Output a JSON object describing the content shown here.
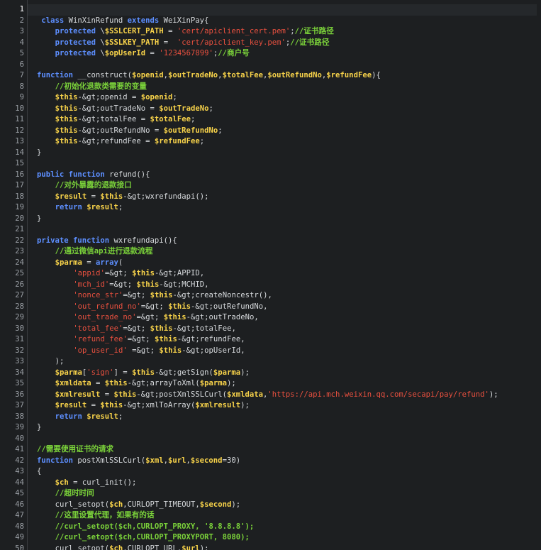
{
  "editor": {
    "lines": [
      {
        "n": "1",
        "indent": 0,
        "tokens": []
      },
      {
        "n": "2",
        "indent": 1,
        "tokens": [
          [
            "kw",
            "class"
          ],
          [
            "pl",
            " WinXinRefund "
          ],
          [
            "kw",
            "extends"
          ],
          [
            "pl",
            " WeiXinPay{"
          ]
        ]
      },
      {
        "n": "3",
        "indent": 4,
        "tokens": [
          [
            "kw",
            "protected"
          ],
          [
            "pl",
            " \\"
          ],
          [
            "var",
            "$SSLCERT_PATH"
          ],
          [
            "pl",
            " = "
          ],
          [
            "str",
            "'cert/apiclient_cert.pem'"
          ],
          [
            "pl",
            ";"
          ],
          [
            "cm",
            "//证书路径"
          ]
        ]
      },
      {
        "n": "4",
        "indent": 4,
        "tokens": [
          [
            "kw",
            "protected"
          ],
          [
            "pl",
            " \\"
          ],
          [
            "var",
            "$SSLKEY_PATH"
          ],
          [
            "pl",
            " =  "
          ],
          [
            "str",
            "'cert/apiclient_key.pem'"
          ],
          [
            "pl",
            ";"
          ],
          [
            "cm",
            "//证书路径"
          ]
        ]
      },
      {
        "n": "5",
        "indent": 4,
        "tokens": [
          [
            "kw",
            "protected"
          ],
          [
            "pl",
            " \\"
          ],
          [
            "var",
            "$opUserId"
          ],
          [
            "pl",
            " = "
          ],
          [
            "str",
            "'1234567899'"
          ],
          [
            "pl",
            ";"
          ],
          [
            "cm",
            "//商户号"
          ]
        ]
      },
      {
        "n": "6",
        "indent": 0,
        "tokens": []
      },
      {
        "n": "7",
        "indent": 0,
        "tokens": [
          [
            "kw",
            "function"
          ],
          [
            "pl",
            " __construct("
          ],
          [
            "var",
            "$openid"
          ],
          [
            "pl",
            ","
          ],
          [
            "var",
            "$outTradeNo"
          ],
          [
            "pl",
            ","
          ],
          [
            "var",
            "$totalFee"
          ],
          [
            "pl",
            ","
          ],
          [
            "var",
            "$outRefundNo"
          ],
          [
            "pl",
            ","
          ],
          [
            "var",
            "$refundFee"
          ],
          [
            "pl",
            "){"
          ]
        ]
      },
      {
        "n": "8",
        "indent": 4,
        "tokens": [
          [
            "cm",
            "//初始化退款类需要的变量"
          ]
        ]
      },
      {
        "n": "9",
        "indent": 4,
        "tokens": [
          [
            "var",
            "$this"
          ],
          [
            "pl",
            "-&gt;openid = "
          ],
          [
            "var",
            "$openid"
          ],
          [
            "pl",
            ";"
          ]
        ]
      },
      {
        "n": "10",
        "indent": 4,
        "tokens": [
          [
            "var",
            "$this"
          ],
          [
            "pl",
            "-&gt;outTradeNo = "
          ],
          [
            "var",
            "$outTradeNo"
          ],
          [
            "pl",
            ";"
          ]
        ]
      },
      {
        "n": "11",
        "indent": 4,
        "tokens": [
          [
            "var",
            "$this"
          ],
          [
            "pl",
            "-&gt;totalFee = "
          ],
          [
            "var",
            "$totalFee"
          ],
          [
            "pl",
            ";"
          ]
        ]
      },
      {
        "n": "12",
        "indent": 4,
        "tokens": [
          [
            "var",
            "$this"
          ],
          [
            "pl",
            "-&gt;outRefundNo = "
          ],
          [
            "var",
            "$outRefundNo"
          ],
          [
            "pl",
            ";"
          ]
        ]
      },
      {
        "n": "13",
        "indent": 4,
        "tokens": [
          [
            "var",
            "$this"
          ],
          [
            "pl",
            "-&gt;refundFee = "
          ],
          [
            "var",
            "$refundFee"
          ],
          [
            "pl",
            ";"
          ]
        ]
      },
      {
        "n": "14",
        "indent": 0,
        "tokens": [
          [
            "pl",
            "}"
          ]
        ]
      },
      {
        "n": "15",
        "indent": 0,
        "tokens": []
      },
      {
        "n": "16",
        "indent": 0,
        "tokens": [
          [
            "kw",
            "public"
          ],
          [
            "pl",
            " "
          ],
          [
            "kw",
            "function"
          ],
          [
            "pl",
            " refund(){"
          ]
        ]
      },
      {
        "n": "17",
        "indent": 4,
        "tokens": [
          [
            "cm",
            "//对外暴露的退款接口"
          ]
        ]
      },
      {
        "n": "18",
        "indent": 4,
        "tokens": [
          [
            "var",
            "$result"
          ],
          [
            "pl",
            " = "
          ],
          [
            "var",
            "$this"
          ],
          [
            "pl",
            "-&gt;wxrefundapi();"
          ]
        ]
      },
      {
        "n": "19",
        "indent": 4,
        "tokens": [
          [
            "kw",
            "return"
          ],
          [
            "pl",
            " "
          ],
          [
            "var",
            "$result"
          ],
          [
            "pl",
            ";"
          ]
        ]
      },
      {
        "n": "20",
        "indent": 0,
        "tokens": [
          [
            "pl",
            "}"
          ]
        ]
      },
      {
        "n": "21",
        "indent": 0,
        "tokens": []
      },
      {
        "n": "22",
        "indent": 0,
        "tokens": [
          [
            "kw",
            "private"
          ],
          [
            "pl",
            " "
          ],
          [
            "kw",
            "function"
          ],
          [
            "pl",
            " wxrefundapi(){"
          ]
        ]
      },
      {
        "n": "23",
        "indent": 4,
        "tokens": [
          [
            "cm",
            "//通过微信api进行退款流程"
          ]
        ]
      },
      {
        "n": "24",
        "indent": 4,
        "tokens": [
          [
            "var",
            "$parma"
          ],
          [
            "pl",
            " = "
          ],
          [
            "kw",
            "array"
          ],
          [
            "pl",
            "("
          ]
        ]
      },
      {
        "n": "25",
        "indent": 8,
        "tokens": [
          [
            "str",
            "'appid'"
          ],
          [
            "pl",
            "=&gt; "
          ],
          [
            "var",
            "$this"
          ],
          [
            "pl",
            "-&gt;APPID,"
          ]
        ]
      },
      {
        "n": "26",
        "indent": 8,
        "tokens": [
          [
            "str",
            "'mch_id'"
          ],
          [
            "pl",
            "=&gt; "
          ],
          [
            "var",
            "$this"
          ],
          [
            "pl",
            "-&gt;MCHID,"
          ]
        ]
      },
      {
        "n": "27",
        "indent": 8,
        "tokens": [
          [
            "str",
            "'nonce_str'"
          ],
          [
            "pl",
            "=&gt; "
          ],
          [
            "var",
            "$this"
          ],
          [
            "pl",
            "-&gt;createNoncestr(),"
          ]
        ]
      },
      {
        "n": "28",
        "indent": 8,
        "tokens": [
          [
            "str",
            "'out_refund_no'"
          ],
          [
            "pl",
            "=&gt; "
          ],
          [
            "var",
            "$this"
          ],
          [
            "pl",
            "-&gt;outRefundNo,"
          ]
        ]
      },
      {
        "n": "29",
        "indent": 8,
        "tokens": [
          [
            "str",
            "'out_trade_no'"
          ],
          [
            "pl",
            "=&gt; "
          ],
          [
            "var",
            "$this"
          ],
          [
            "pl",
            "-&gt;outTradeNo,"
          ]
        ]
      },
      {
        "n": "30",
        "indent": 8,
        "tokens": [
          [
            "str",
            "'total_fee'"
          ],
          [
            "pl",
            "=&gt; "
          ],
          [
            "var",
            "$this"
          ],
          [
            "pl",
            "-&gt;totalFee,"
          ]
        ]
      },
      {
        "n": "31",
        "indent": 8,
        "tokens": [
          [
            "str",
            "'refund_fee'"
          ],
          [
            "pl",
            "=&gt; "
          ],
          [
            "var",
            "$this"
          ],
          [
            "pl",
            "-&gt;refundFee,"
          ]
        ]
      },
      {
        "n": "32",
        "indent": 8,
        "tokens": [
          [
            "str",
            "'op_user_id'"
          ],
          [
            "pl",
            " =&gt; "
          ],
          [
            "var",
            "$this"
          ],
          [
            "pl",
            "-&gt;opUserId,"
          ]
        ]
      },
      {
        "n": "33",
        "indent": 4,
        "tokens": [
          [
            "pl",
            ");"
          ]
        ]
      },
      {
        "n": "34",
        "indent": 4,
        "tokens": [
          [
            "var",
            "$parma"
          ],
          [
            "pl",
            "["
          ],
          [
            "str",
            "'sign'"
          ],
          [
            "pl",
            "] = "
          ],
          [
            "var",
            "$this"
          ],
          [
            "pl",
            "-&gt;getSign("
          ],
          [
            "var",
            "$parma"
          ],
          [
            "pl",
            ");"
          ]
        ]
      },
      {
        "n": "35",
        "indent": 4,
        "tokens": [
          [
            "var",
            "$xmldata"
          ],
          [
            "pl",
            " = "
          ],
          [
            "var",
            "$this"
          ],
          [
            "pl",
            "-&gt;arrayToXml("
          ],
          [
            "var",
            "$parma"
          ],
          [
            "pl",
            ");"
          ]
        ]
      },
      {
        "n": "36",
        "indent": 4,
        "tokens": [
          [
            "var",
            "$xmlresult"
          ],
          [
            "pl",
            " = "
          ],
          [
            "var",
            "$this"
          ],
          [
            "pl",
            "-&gt;postXmlSSLCurl("
          ],
          [
            "var",
            "$xmldata"
          ],
          [
            "pl",
            ","
          ],
          [
            "str",
            "'https://api.mch.weixin.qq.com/secapi/pay/refund'"
          ],
          [
            "pl",
            ");"
          ]
        ]
      },
      {
        "n": "37",
        "indent": 4,
        "tokens": [
          [
            "var",
            "$result"
          ],
          [
            "pl",
            " = "
          ],
          [
            "var",
            "$this"
          ],
          [
            "pl",
            "-&gt;xmlToArray("
          ],
          [
            "var",
            "$xmlresult"
          ],
          [
            "pl",
            ");"
          ]
        ]
      },
      {
        "n": "38",
        "indent": 4,
        "tokens": [
          [
            "kw",
            "return"
          ],
          [
            "pl",
            " "
          ],
          [
            "var",
            "$result"
          ],
          [
            "pl",
            ";"
          ]
        ]
      },
      {
        "n": "39",
        "indent": 0,
        "tokens": [
          [
            "pl",
            "}"
          ]
        ]
      },
      {
        "n": "40",
        "indent": 0,
        "tokens": []
      },
      {
        "n": "41",
        "indent": 0,
        "tokens": [
          [
            "cm",
            "//需要使用证书的请求"
          ]
        ]
      },
      {
        "n": "42",
        "indent": 0,
        "tokens": [
          [
            "kw",
            "function"
          ],
          [
            "pl",
            " postXmlSSLCurl("
          ],
          [
            "var",
            "$xml"
          ],
          [
            "pl",
            ","
          ],
          [
            "var",
            "$url"
          ],
          [
            "pl",
            ","
          ],
          [
            "var",
            "$second"
          ],
          [
            "pl",
            "=30)"
          ]
        ]
      },
      {
        "n": "43",
        "indent": 0,
        "tokens": [
          [
            "pl",
            "{"
          ]
        ]
      },
      {
        "n": "44",
        "indent": 4,
        "tokens": [
          [
            "var",
            "$ch"
          ],
          [
            "pl",
            " = curl_init();"
          ]
        ]
      },
      {
        "n": "45",
        "indent": 4,
        "tokens": [
          [
            "cm",
            "//超时时间"
          ]
        ]
      },
      {
        "n": "46",
        "indent": 4,
        "tokens": [
          [
            "pl",
            "curl_setopt("
          ],
          [
            "var",
            "$ch"
          ],
          [
            "pl",
            ",CURLOPT_TIMEOUT,"
          ],
          [
            "var",
            "$second"
          ],
          [
            "pl",
            ");"
          ]
        ]
      },
      {
        "n": "47",
        "indent": 4,
        "tokens": [
          [
            "cm",
            "//这里设置代理，如果有的话"
          ]
        ]
      },
      {
        "n": "48",
        "indent": 4,
        "tokens": [
          [
            "cm",
            "//curl_setopt($ch,CURLOPT_PROXY, '8.8.8.8');"
          ]
        ]
      },
      {
        "n": "49",
        "indent": 4,
        "tokens": [
          [
            "cm",
            "//curl_setopt($ch,CURLOPT_PROXYPORT, 8080);"
          ]
        ]
      },
      {
        "n": "50",
        "indent": 4,
        "tokens": [
          [
            "pl",
            "curl_setopt("
          ],
          [
            "var",
            "$ch"
          ],
          [
            "pl",
            ",CURLOPT_URL,"
          ],
          [
            "var",
            "$url"
          ],
          [
            "pl",
            ");"
          ]
        ]
      }
    ],
    "active_line": "1"
  }
}
